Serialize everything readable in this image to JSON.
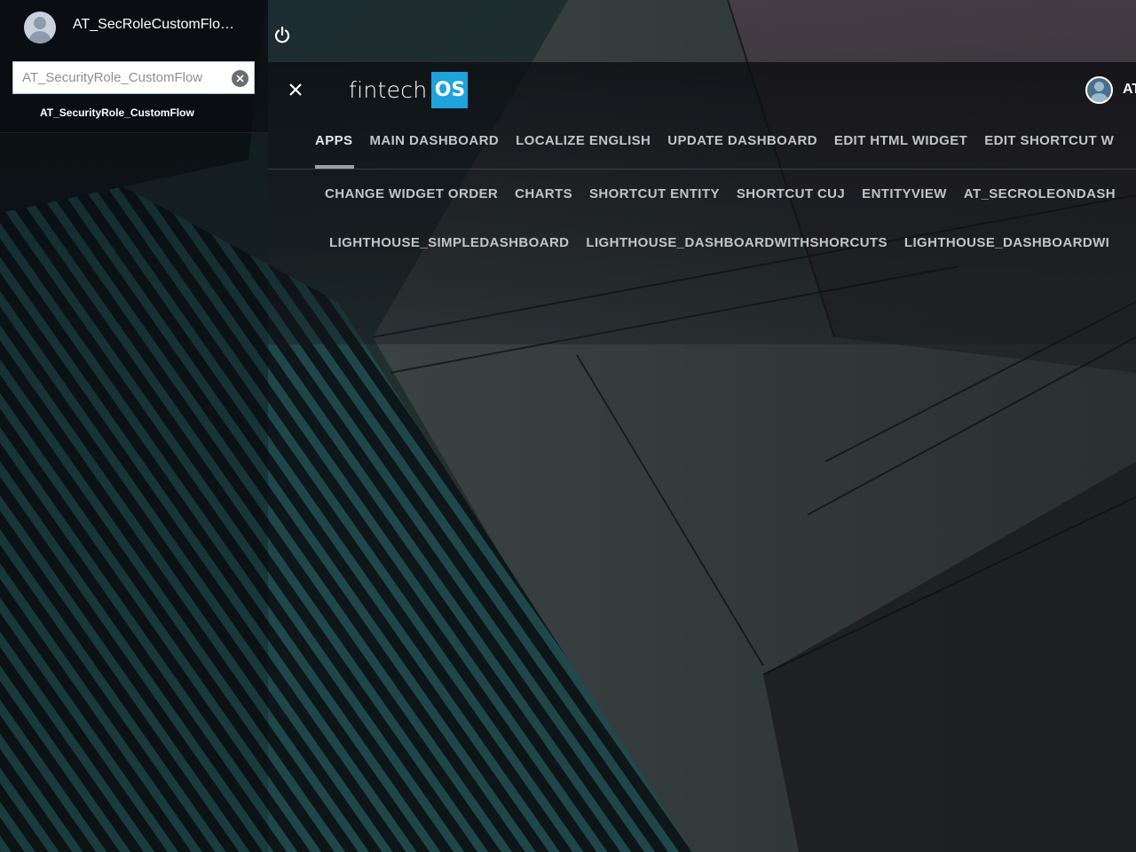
{
  "user": {
    "name": "AT_SecRoleCustomFlow_...",
    "short_name": "AT"
  },
  "search": {
    "value": "AT_SecurityRole_CustomFlow",
    "results": [
      "AT_SecurityRole_CustomFlow"
    ]
  },
  "brand": {
    "text": "fintech",
    "badge": "OS",
    "badge_color": "#1ea3dd"
  },
  "tabs": {
    "row1": [
      "APPS",
      "MAIN DASHBOARD",
      "LOCALIZE ENGLISH",
      "UPDATE DASHBOARD",
      "EDIT HTML WIDGET",
      "EDIT SHORTCUT W"
    ],
    "row2": [
      "CHANGE WIDGET ORDER",
      "CHARTS",
      "SHORTCUT ENTITY",
      "SHORTCUT CUJ",
      "ENTITYVIEW",
      "AT_SECROLEONDASH"
    ],
    "row3": [
      "LIGHTHOUSE_SIMPLEDASHBOARD",
      "LIGHTHOUSE_DASHBOARDWITHSHORCUTS",
      "LIGHTHOUSE_DASHBOARDWI"
    ],
    "active": "APPS"
  },
  "icons": {
    "power": "power-icon",
    "close": "close-icon",
    "clear": "clear-icon"
  }
}
